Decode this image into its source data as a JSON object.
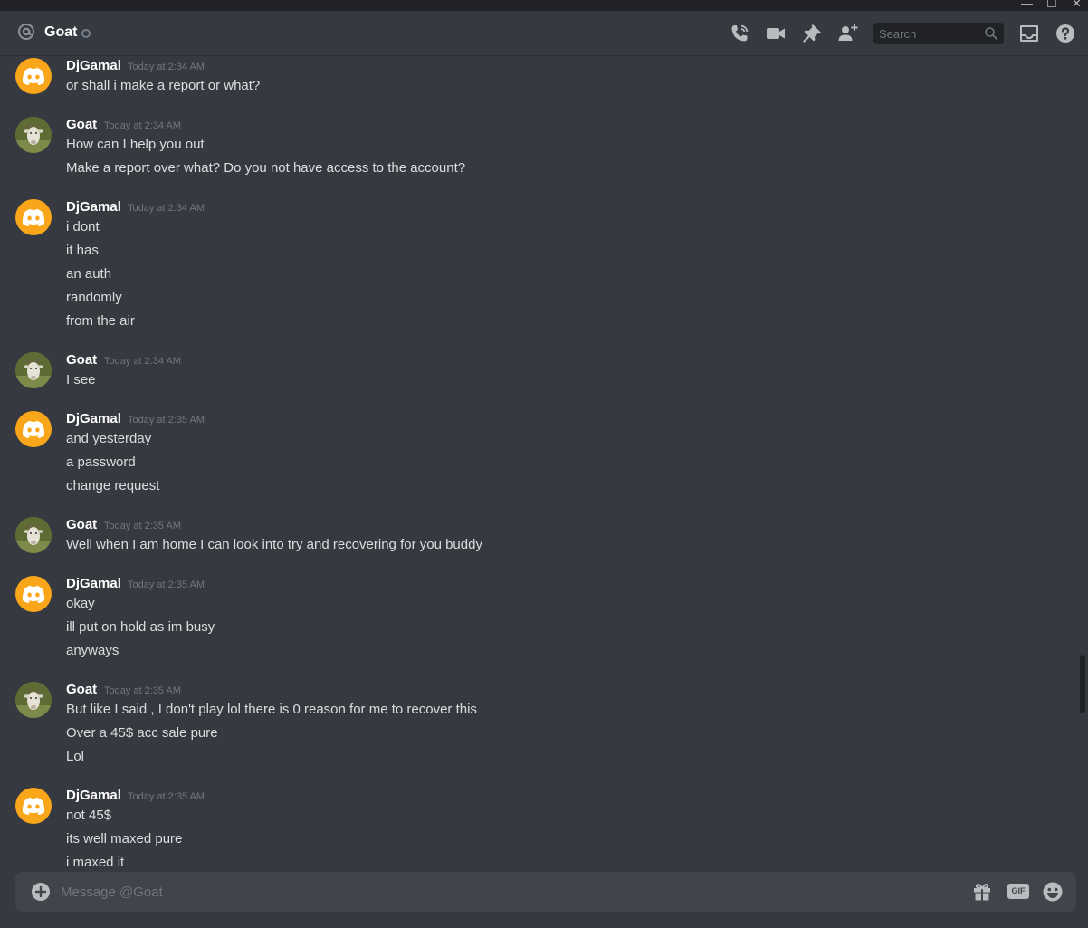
{
  "window": {
    "minimize": "—",
    "maximize": "☐",
    "close": "✕"
  },
  "header": {
    "recipient": "Goat",
    "search_placeholder": "Search",
    "icons": [
      "at-icon",
      "call-icon",
      "video-icon",
      "pin-icon",
      "add-member-icon",
      "search-icon",
      "inbox-icon",
      "help-icon"
    ]
  },
  "messages": [
    {
      "author": "DjGamal",
      "timestamp": "Today at 2:34 AM",
      "avatar": "discord-logo",
      "lines": [
        "or shall i make a report or what?"
      ]
    },
    {
      "author": "Goat",
      "timestamp": "Today at 2:34 AM",
      "avatar": "goat-photo",
      "lines": [
        "How can I help you out",
        "Make a report over what? Do you not have access to the account?"
      ]
    },
    {
      "author": "DjGamal",
      "timestamp": "Today at 2:34 AM",
      "avatar": "discord-logo",
      "lines": [
        "i dont",
        "it has",
        "an auth",
        "randomly",
        "from the air"
      ]
    },
    {
      "author": "Goat",
      "timestamp": "Today at 2:34 AM",
      "avatar": "goat-photo",
      "lines": [
        "I see"
      ]
    },
    {
      "author": "DjGamal",
      "timestamp": "Today at 2:35 AM",
      "avatar": "discord-logo",
      "lines": [
        "and yesterday",
        "a password",
        "change request"
      ]
    },
    {
      "author": "Goat",
      "timestamp": "Today at 2:35 AM",
      "avatar": "goat-photo",
      "lines": [
        "Well when I am home I can look into try and recovering for you buddy"
      ]
    },
    {
      "author": "DjGamal",
      "timestamp": "Today at 2:35 AM",
      "avatar": "discord-logo",
      "lines": [
        "okay",
        "ill put on hold as im busy",
        "anyways"
      ]
    },
    {
      "author": "Goat",
      "timestamp": "Today at 2:35 AM",
      "avatar": "goat-photo",
      "lines": [
        "But like I said , I don't play lol there is 0 reason for me to recover this",
        "Over a 45$ acc sale pure",
        "Lol"
      ]
    },
    {
      "author": "DjGamal",
      "timestamp": "Today at 2:35 AM",
      "avatar": "discord-logo",
      "lines": [
        "not 45$",
        "its well maxed pure",
        "i maxed it"
      ]
    }
  ],
  "composer": {
    "placeholder": "Message @Goat",
    "gif_label": "GIF",
    "icons": [
      "plus-icon",
      "gift-icon",
      "gif-icon",
      "emoji-icon"
    ]
  },
  "colors": {
    "background": "#36393f",
    "titlebar": "#202225",
    "composer": "#40444b",
    "discord_avatar": "#faa61a",
    "username": "#ffffff",
    "text": "#dcddde",
    "timestamp": "#72767d"
  }
}
